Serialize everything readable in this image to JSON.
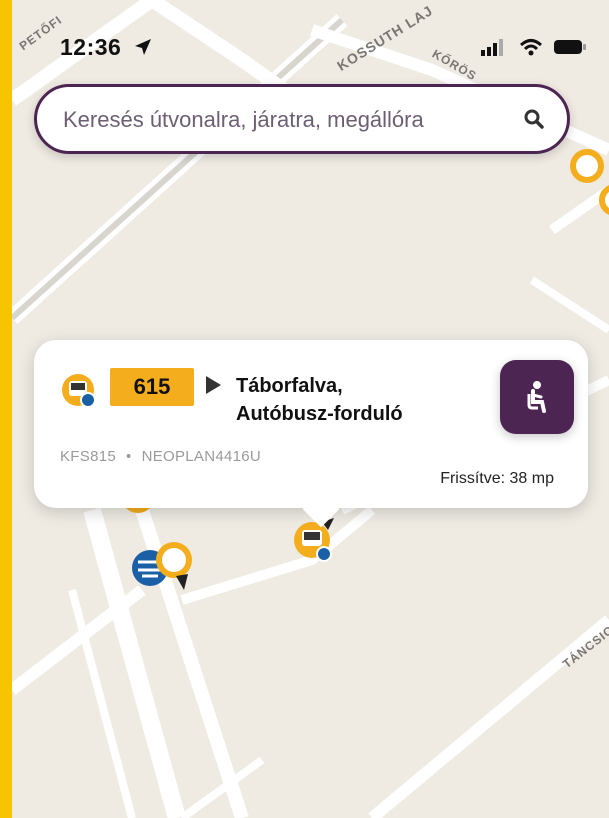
{
  "status_bar": {
    "time": "12:36"
  },
  "search": {
    "placeholder": "Keresés útvonalra, járatra, megállóra"
  },
  "map": {
    "streets": [
      "PETŐFI",
      "KOSSUTH LAJ",
      "KŐRÖS",
      "TÁNCSIC"
    ]
  },
  "vehicle_card": {
    "route_number": "615",
    "destination_line1": "Táborfalva,",
    "destination_line2": "Autóbusz-forduló",
    "plate": "KFS815",
    "model": "NEOPLAN4416U",
    "separator": "•",
    "updated": "Frissítve: 38 mp"
  },
  "colors": {
    "frame": "#f7c500",
    "accent_purple": "#4d2552",
    "route_badge": "#f4ad1d",
    "stop_orange": "#f4ad1d",
    "rail_blue": "#1b5fa7"
  }
}
